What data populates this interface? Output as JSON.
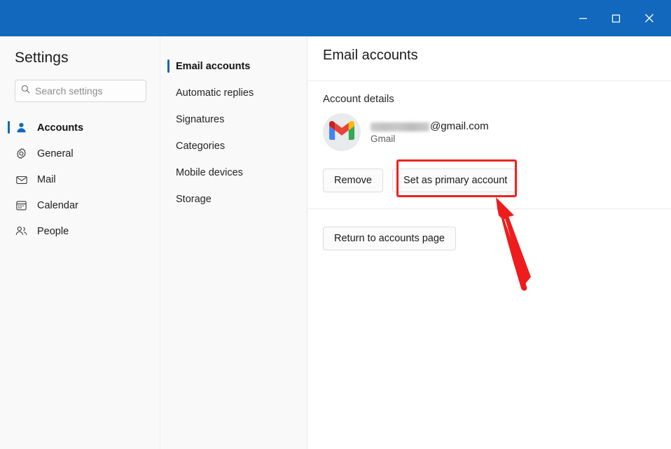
{
  "window": {
    "titlebar_color": "#1168bd",
    "controls": [
      {
        "name": "minimize",
        "glyph": "minimize-icon"
      },
      {
        "name": "maximize",
        "glyph": "maximize-icon"
      },
      {
        "name": "close",
        "glyph": "close-icon"
      }
    ]
  },
  "sidebar": {
    "title": "Settings",
    "search": {
      "placeholder": "Search settings",
      "value": "",
      "icon": "search-icon"
    },
    "items": [
      {
        "label": "Accounts",
        "icon": "person-icon",
        "selected": true
      },
      {
        "label": "General",
        "icon": "gear-icon",
        "selected": false
      },
      {
        "label": "Mail",
        "icon": "envelope-icon",
        "selected": false
      },
      {
        "label": "Calendar",
        "icon": "calendar-icon",
        "selected": false
      },
      {
        "label": "People",
        "icon": "people-icon",
        "selected": false
      }
    ]
  },
  "subnav": {
    "items": [
      {
        "label": "Email accounts",
        "selected": true
      },
      {
        "label": "Automatic replies",
        "selected": false
      },
      {
        "label": "Signatures",
        "selected": false
      },
      {
        "label": "Categories",
        "selected": false
      },
      {
        "label": "Mobile devices",
        "selected": false
      },
      {
        "label": "Storage",
        "selected": false
      }
    ]
  },
  "main": {
    "page_title": "Email accounts",
    "section_title": "Account details",
    "account": {
      "email_suffix": "@gmail.com",
      "email_redacted": true,
      "provider": "Gmail",
      "avatar_icon": "gmail-logo-icon"
    },
    "buttons": {
      "remove": "Remove",
      "set_primary": "Set as primary account",
      "return": "Return to accounts page"
    }
  },
  "annotation": {
    "highlight_target": "Set as primary account",
    "color": "#ef2121",
    "shapes": [
      "rectangle",
      "arrow"
    ]
  },
  "accent_color": "#1168bd"
}
